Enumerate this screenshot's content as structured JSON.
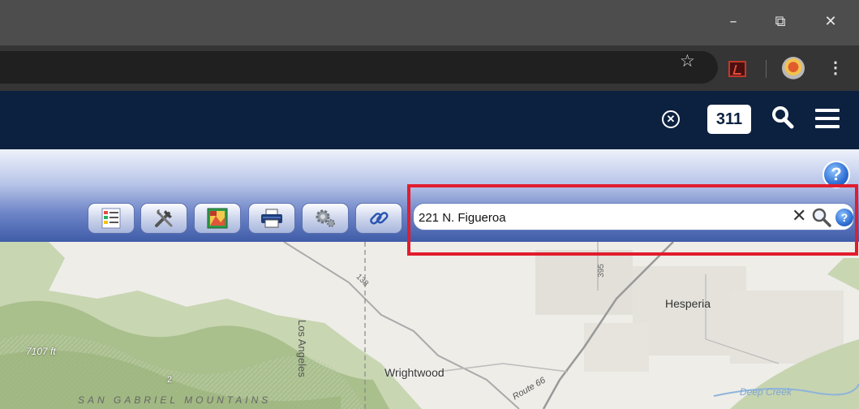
{
  "window": {
    "minimize": "–",
    "restore": "⧉",
    "close": "✕"
  },
  "browser": {
    "bookmark_icon": "star-icon",
    "extensions": [
      "pdf-extension-icon",
      "profile-seal-icon"
    ],
    "menu_icon": "kebab-menu-icon"
  },
  "site_header": {
    "background": "#0c2140",
    "clear_label": "⊗",
    "badge_311": "311",
    "search_icon": "search-icon",
    "menu_icon": "hamburger-menu-icon"
  },
  "map_toolbar": {
    "help": "?",
    "tools": [
      {
        "name": "layers-list-icon"
      },
      {
        "name": "tools-icon"
      },
      {
        "name": "basemap-icon"
      },
      {
        "name": "print-icon"
      },
      {
        "name": "settings-icon"
      },
      {
        "name": "link-icon"
      }
    ]
  },
  "search": {
    "value": "221 N. Figueroa",
    "clear": "✕",
    "help": "?"
  },
  "map": {
    "labels": {
      "elevation": "7107 ft",
      "mountains": "SAN GABRIEL MOUNTAINS",
      "town1": "Wrightwood",
      "town2": "Hesperia",
      "county": "Los Angeles",
      "route66": "Route 66",
      "creek": "Deep Creek",
      "hwy138": "138",
      "hwy395": "395",
      "hwy2": "2"
    }
  }
}
